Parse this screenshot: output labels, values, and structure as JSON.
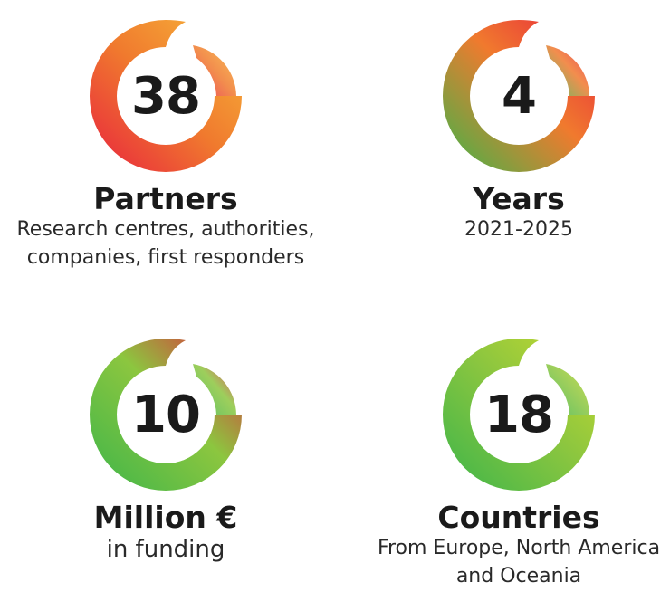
{
  "stats": [
    {
      "number": "38",
      "label": "Partners",
      "description": "Research centres, authorities,\ncompanies, first responders",
      "gradient": [
        "#e8223e",
        "#f07a2e",
        "#f7b83a"
      ]
    },
    {
      "number": "4",
      "label": "Years",
      "description": "2021-2025",
      "gradient": [
        "#3db54a",
        "#f07a2e",
        "#e8223e"
      ]
    },
    {
      "number": "10",
      "label": "Million €",
      "description": "in funding",
      "gradient": [
        "#3db54a",
        "#8cc63f",
        "#e8223e"
      ]
    },
    {
      "number": "18",
      "label": "Countries",
      "description": "From Europe, North America\nand Oceania",
      "gradient": [
        "#3db54a",
        "#8cc63f",
        "#c6d92f"
      ]
    }
  ]
}
